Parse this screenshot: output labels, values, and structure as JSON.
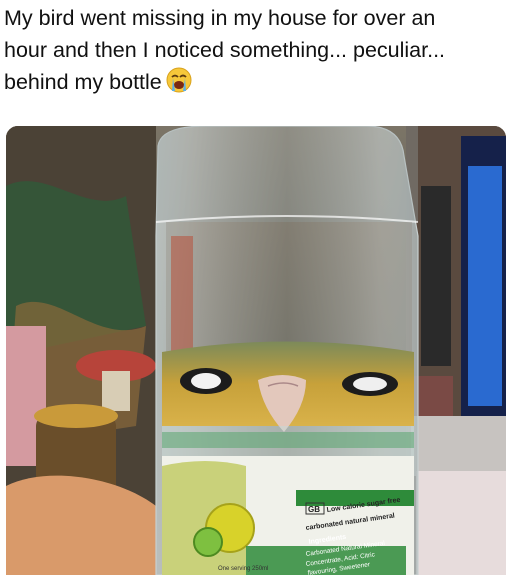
{
  "post": {
    "caption_lines": [
      "My bird went missing in my house for over an",
      "hour and then I noticed something... peculiar...",
      "behind my bottle"
    ],
    "emoji": "crying-face"
  },
  "bottle_label": {
    "badge": "GB",
    "line1": "Low calorie sugar free",
    "line2": "carbonated natural mineral",
    "ingredients_heading": "Ingredients",
    "ing1": "Carbonated Natural Mineral",
    "ing2": "Concentrate, Acid: Citric",
    "ing3": "flavouring, Sweetener",
    "serving": "One serving 250ml"
  },
  "colors": {
    "text": "#111111",
    "label_green": "#2e8b3a",
    "lemon": "#d8d22a"
  }
}
